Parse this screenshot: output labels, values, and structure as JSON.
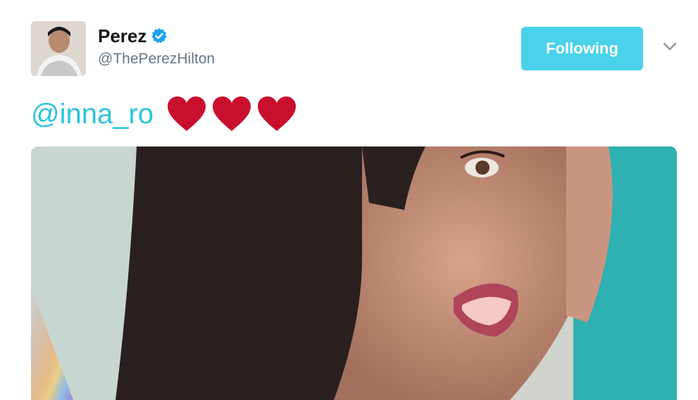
{
  "tweet": {
    "author": {
      "display_name": "Perez",
      "handle": "@ThePerezHilton",
      "verified": true,
      "avatar_icon": "profile-photo"
    },
    "follow_button_label": "Following",
    "follow_button_color": "#4ad2ea",
    "text": {
      "mention": "@inna_ro",
      "hearts_count": 3,
      "heart_color": "#c8102e"
    },
    "media": {
      "type": "photo"
    }
  },
  "colors": {
    "link": "#2bc4dd",
    "verified_badge": "#1da1f2",
    "secondary_text": "#657786"
  }
}
